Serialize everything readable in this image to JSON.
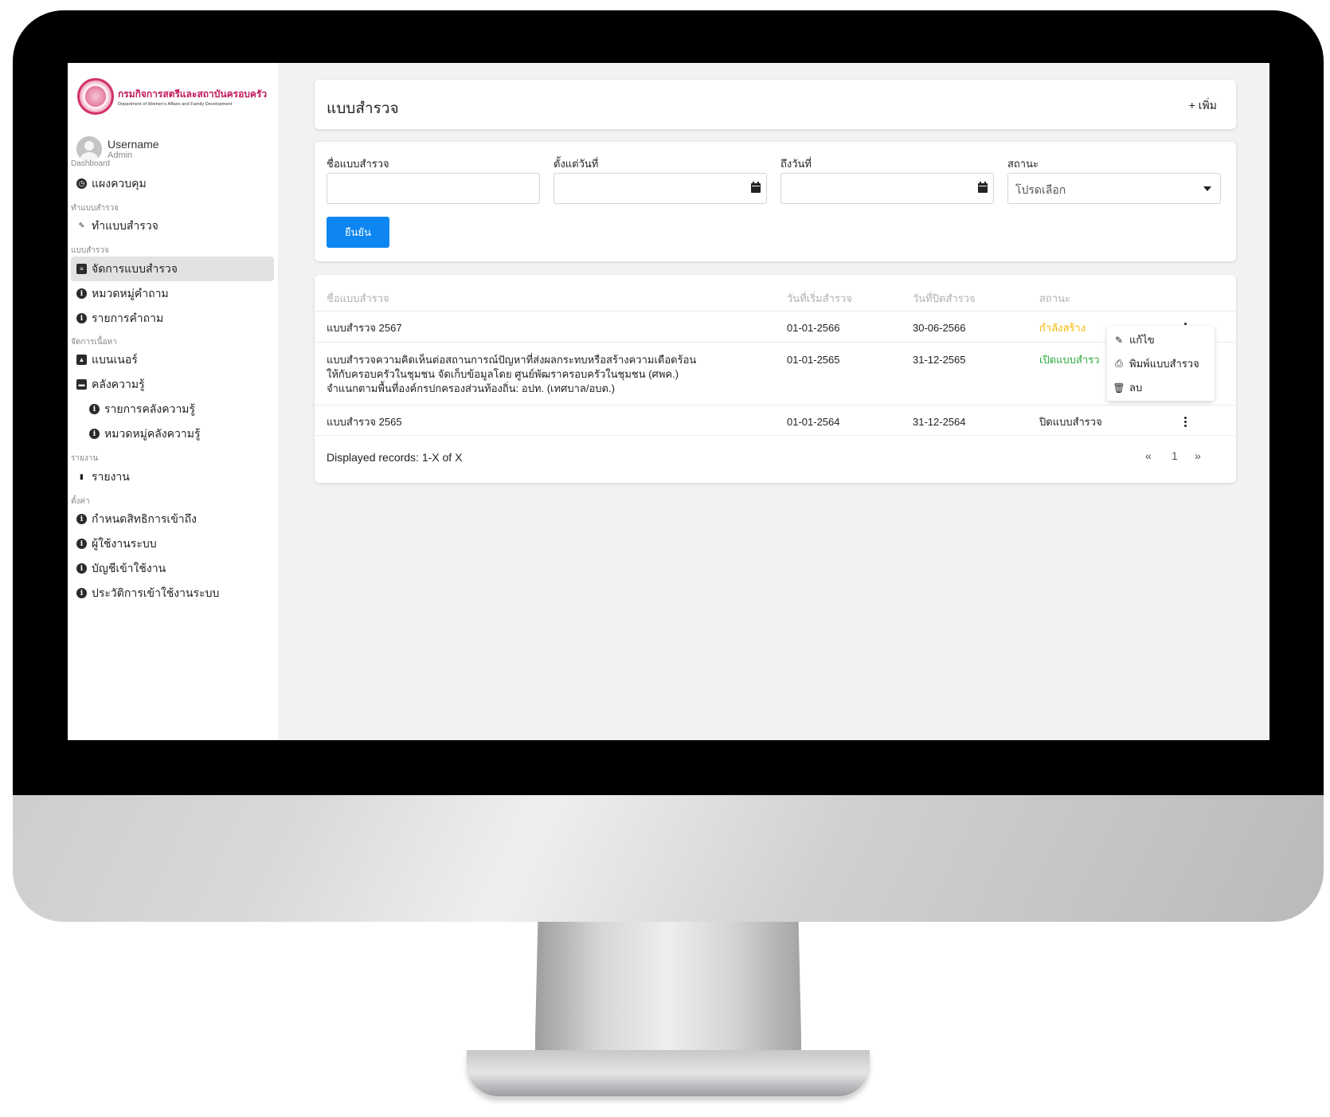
{
  "sidebar": {
    "logo_th": "กรมกิจการสตรีและสถาบันครอบครัว",
    "logo_en": "Department of Women's Affairs and Family Development",
    "user": {
      "name": "Username",
      "role": "Admin"
    },
    "sections": [
      {
        "title": "Dashboard",
        "items": [
          {
            "label": "แผงควบคุม",
            "icon": "dashboard-icon"
          }
        ]
      },
      {
        "title": "ทำแบบสำรวจ",
        "items": [
          {
            "label": "ทำแบบสำรวจ",
            "icon": "edit-form-icon"
          }
        ]
      },
      {
        "title": "แบบสำรวจ",
        "items": [
          {
            "label": "จัดการแบบสำรวจ",
            "icon": "clipboard-icon",
            "active": true
          },
          {
            "label": "หมวดหมู่คำถาม",
            "icon": "info-icon"
          },
          {
            "label": "รายการคำถาม",
            "icon": "info-icon"
          }
        ]
      },
      {
        "title": "จัดการเนื้อหา",
        "items": [
          {
            "label": "แบนเนอร์",
            "icon": "image-icon"
          },
          {
            "label": "คลังความรู้",
            "icon": "book-icon"
          },
          {
            "label": "รายการคลังความรู้",
            "icon": "info-icon",
            "sub": true
          },
          {
            "label": "หมวดหมู่คลังความรู้",
            "icon": "info-icon",
            "sub": true
          }
        ]
      },
      {
        "title": "รายงาน",
        "items": [
          {
            "label": "รายงาน",
            "icon": "file-icon"
          }
        ]
      },
      {
        "title": "ตั้งค่า",
        "items": [
          {
            "label": "กำหนดสิทธิการเข้าถึง",
            "icon": "info-icon"
          },
          {
            "label": "ผู้ใช้งานระบบ",
            "icon": "info-icon"
          },
          {
            "label": "บัญชีเข้าใช้งาน",
            "icon": "info-icon"
          },
          {
            "label": "ประวัติการเข้าใช้งานระบบ",
            "icon": "info-icon"
          }
        ]
      }
    ]
  },
  "header": {
    "title": "แบบสำรวจ",
    "add_label": "+ เพิ่ม"
  },
  "filters": {
    "name_label": "ชื่อแบบสำรวจ",
    "from_label": "ตั้งแต่วันที่",
    "to_label": "ถึงวันที่",
    "status_label": "สถานะ",
    "status_value": "โปรดเลือก",
    "confirm_label": "ยืนยัน"
  },
  "table": {
    "columns": [
      "ชื่อแบบสำรวจ",
      "วันที่เริ่มสำรวจ",
      "วันที่ปิดสำรวจ",
      "สถานะ"
    ],
    "rows": [
      {
        "name": [
          "แบบสำรวจ 2567"
        ],
        "start": "01-01-2566",
        "end": "30-06-2566",
        "status": "กำลังสร้าง",
        "status_color": "#f5b800"
      },
      {
        "name": [
          "แบบสำรวจความคิดเห็นต่อสถานการณ์ปัญหาที่ส่งผลกระทบหรือสร้างความเดือดร้อน",
          "ให้กับครอบครัวในชุมชน จัดเก็บข้อมูลโดย ศูนย์พัฒราครอบครัวในชุมชน (ศพค.)",
          "จำแนกตามพื้นที่องค์กรปกครองส่วนท้องถิ่น: อปท. (เทศบาล/อบต.)"
        ],
        "start": "01-01-2565",
        "end": "31-12-2565",
        "status": "เปิดแบบสำรว",
        "status_color": "#2eaa3f"
      },
      {
        "name": [
          "แบบสำรวจ 2565"
        ],
        "start": "01-01-2564",
        "end": "31-12-2564",
        "status": "ปิดแบบสำรวจ",
        "status_color": "#222222"
      }
    ],
    "footer": "Displayed records: 1-X of X",
    "pagination": {
      "prev": "«",
      "page": "1",
      "next": "»"
    }
  },
  "row_menu": {
    "items": [
      {
        "label": "แก้ไข",
        "icon": "pencil-icon"
      },
      {
        "label": "พิมพ์แบบสำรวจ",
        "icon": "printer-icon"
      },
      {
        "label": "ลบ",
        "icon": "trash-icon"
      }
    ]
  }
}
